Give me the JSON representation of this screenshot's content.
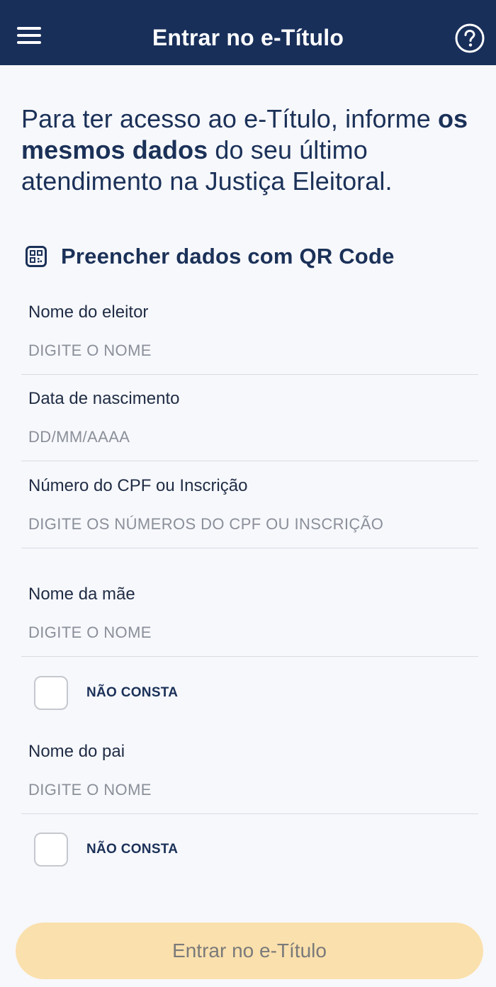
{
  "header": {
    "title": "Entrar no e-Título",
    "menu_icon": "hamburger-menu-icon",
    "help_icon": "question-circle-icon",
    "background": "#182f5a"
  },
  "intro": {
    "part1": "Para ter acesso ao e-Título, informe ",
    "bold": "os mesmos dados",
    "part2": " do seu último atendimento na Justiça Eleitoral."
  },
  "qr": {
    "label": "Preencher dados com QR Code",
    "icon": "qr-code-icon"
  },
  "form": {
    "voter_name": {
      "label": "Nome do eleitor",
      "placeholder": "DIGITE O NOME",
      "value": ""
    },
    "birth_date": {
      "label": "Data de nascimento",
      "placeholder": "DD/MM/AAAA",
      "value": ""
    },
    "cpf": {
      "label": "Número do CPF ou Inscrição",
      "placeholder": "DIGITE OS NÚMEROS DO CPF OU INSCRIÇÃO",
      "value": ""
    },
    "mother_name": {
      "label": "Nome da mãe",
      "placeholder": "DIGITE O NOME",
      "value": "",
      "not_listed_label": "NÃO CONSTA",
      "not_listed_checked": false
    },
    "father_name": {
      "label": "Nome do pai",
      "placeholder": "DIGITE O NOME",
      "value": "",
      "not_listed_label": "NÃO CONSTA",
      "not_listed_checked": false
    }
  },
  "submit": {
    "label": "Entrar no e-Título",
    "color": "#fae0ad",
    "enabled": false
  }
}
